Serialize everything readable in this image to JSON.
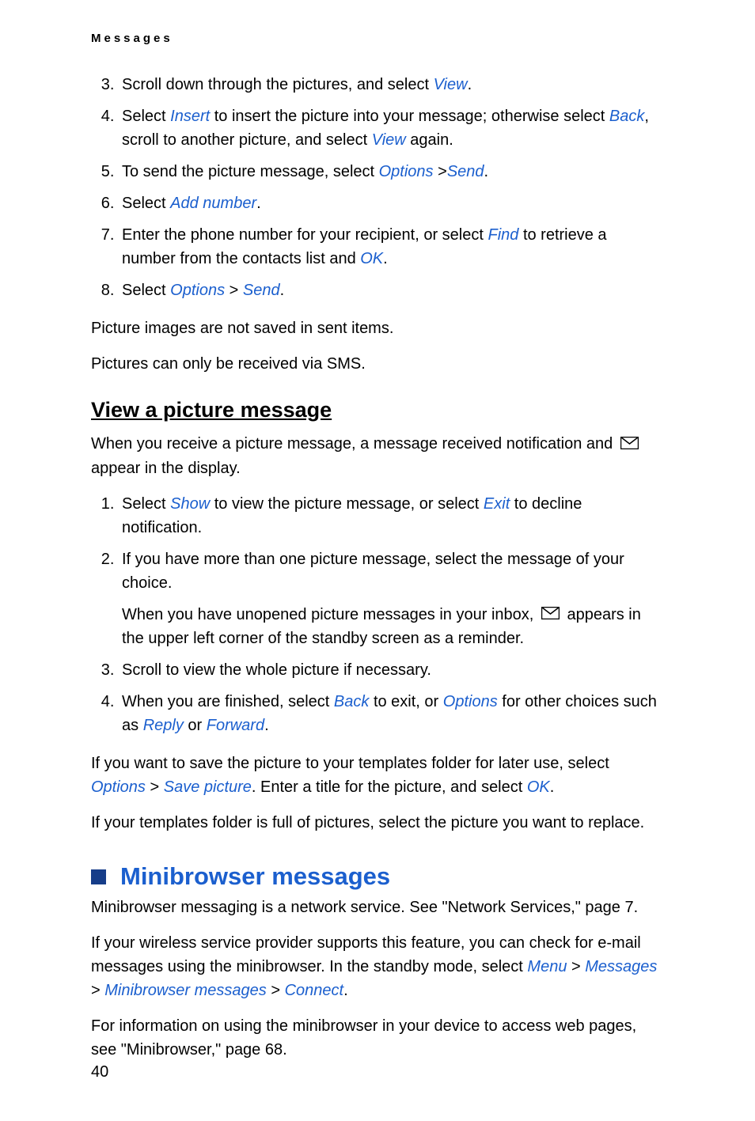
{
  "header": "Messages",
  "list1": {
    "start": 3,
    "items": [
      {
        "pre": "Scroll down through the pictures, and select ",
        "a": "View",
        "post": "."
      },
      {
        "pre": "Select ",
        "a": "Insert",
        "mid1": " to insert the picture into your message; otherwise select ",
        "b": "Back",
        "mid2": ", scroll to another picture, and select ",
        "c": "View",
        "post": " again."
      },
      {
        "pre": "To send the picture message, select ",
        "a": "Options",
        "mid1": " >",
        "b": "Send",
        "post": "."
      },
      {
        "pre": "Select ",
        "a": "Add number",
        "post": "."
      },
      {
        "pre": "Enter the phone number for your recipient, or select ",
        "a": "Find",
        "mid1": " to retrieve a number from the contacts list and ",
        "b": "OK",
        "post": "."
      },
      {
        "pre": "Select ",
        "a": "Options",
        "mid1": " > ",
        "b": "Send",
        "post": "."
      }
    ]
  },
  "p_after1": [
    "Picture images are not saved in sent items.",
    "Pictures can only be received via SMS."
  ],
  "heading_view": "View a picture message",
  "p_view_intro_pre": "When you receive a picture message, a message received notification and ",
  "p_view_intro_post": " appear in the display.",
  "list2": {
    "items": [
      {
        "pre": "Select ",
        "a": "Show",
        "mid1": " to view the picture message, or select ",
        "b": "Exit",
        "post": " to decline notification."
      },
      {
        "pre": "If you have more than one picture message, select the message of your choice.",
        "sub_pre": "When you have unopened picture messages in your inbox, ",
        "sub_post": " appears in the upper left corner of the standby screen as a reminder."
      },
      {
        "pre": "Scroll to view the whole picture if necessary."
      },
      {
        "pre": "When you are finished, select ",
        "a": "Back",
        "mid1": " to exit, or ",
        "b": "Options",
        "mid2": " for other choices such as ",
        "c": "Reply",
        "mid3": " or ",
        "d": "Forward",
        "post": "."
      }
    ]
  },
  "p_save": {
    "pre": "If you want to save the picture to your templates folder for later use, select ",
    "a": "Options",
    "mid1": " > ",
    "b": "Save picture",
    "mid2": ". Enter a title for the picture, and select ",
    "c": "OK",
    "post": "."
  },
  "p_templates_full": "If your templates folder is full of pictures, select the picture you want to replace.",
  "heading_mini": "Minibrowser messages",
  "p_mini1": "Minibrowser messaging is a network service. See \"Network Services,\" page 7.",
  "p_mini2": {
    "pre": "If your wireless service provider supports this feature, you can check for e-mail messages using the minibrowser. In the standby mode, select ",
    "a": "Menu",
    "mid1": " > ",
    "b": "Messages",
    "mid2": " > ",
    "c": "Minibrowser messages",
    "mid3": " > ",
    "d": "Connect",
    "post": "."
  },
  "p_mini3": "For information on using the minibrowser in your device to access web pages, see \"Minibrowser,\" page 68.",
  "pagenum": "40"
}
